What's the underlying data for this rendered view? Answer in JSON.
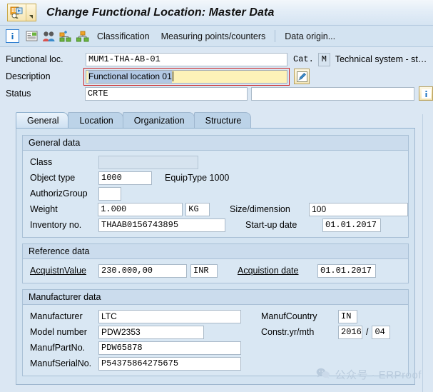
{
  "window": {
    "title": "Change Functional Location: Master Data",
    "app_icon": "sap-functional-location-icon",
    "menu_arrow": "dropdown-arrow-icon"
  },
  "toolbar": {
    "icons": [
      {
        "name": "info-icon",
        "glyph": "i"
      },
      {
        "name": "document-list-icon",
        "glyph": ""
      },
      {
        "name": "partners-icon",
        "glyph": ""
      },
      {
        "name": "create-structure-icon",
        "glyph": ""
      },
      {
        "name": "structure-hierarchy-icon",
        "glyph": ""
      }
    ],
    "buttons": [
      {
        "name": "classification-button",
        "label": "Classification"
      },
      {
        "name": "measuring-points-button",
        "label": "Measuring points/counters"
      },
      {
        "name": "data-origin-button",
        "label": "Data origin..."
      }
    ]
  },
  "header": {
    "functional_loc": {
      "label": "Functional loc.",
      "value": "MUM1-THA-AB-01"
    },
    "category": {
      "label": "Cat.",
      "value": "M",
      "description": "Technical system - st…"
    },
    "description": {
      "label": "Description",
      "value": "Functional location 01",
      "edit_icon": "pencil-edit-icon"
    },
    "status": {
      "label": "Status",
      "value": "CRTE",
      "value2": "",
      "info_icon": "status-info-icon"
    }
  },
  "tabs": [
    {
      "name": "tab-general",
      "label": "General",
      "active": true
    },
    {
      "name": "tab-location",
      "label": "Location",
      "active": false
    },
    {
      "name": "tab-organization",
      "label": "Organization",
      "active": false
    },
    {
      "name": "tab-structure",
      "label": "Structure",
      "active": false
    }
  ],
  "general_data": {
    "title": "General data",
    "class": {
      "label": "Class",
      "value": ""
    },
    "object_type": {
      "label": "Object type",
      "value": "1000",
      "text": "EquipType 1000"
    },
    "authoriz_group": {
      "label": "AuthorizGroup",
      "value": ""
    },
    "weight": {
      "label": "Weight",
      "value": "1.000",
      "uom": "KG"
    },
    "size_dimension": {
      "label": "Size/dimension",
      "value": "100"
    },
    "inventory_no": {
      "label": "Inventory no.",
      "value": "THAAB0156743895"
    },
    "startup_date": {
      "label": "Start-up date",
      "value": "01.01.2017"
    }
  },
  "reference_data": {
    "title": "Reference data",
    "acquisition_value": {
      "label": "AcquistnValue",
      "value": "230.000,00",
      "currency": "INR"
    },
    "acquisition_date": {
      "label": "Acquistion date",
      "value": "01.01.2017"
    }
  },
  "manufacturer_data": {
    "title": "Manufacturer data",
    "manufacturer": {
      "label": "Manufacturer",
      "value": "LTC"
    },
    "manuf_country": {
      "label": "ManufCountry",
      "value": "IN"
    },
    "model_number": {
      "label": "Model number",
      "value": "PDW2353"
    },
    "constr_yr_mth": {
      "label": "Constr.yr/mth",
      "year": "2016",
      "separator": "/",
      "month": "04"
    },
    "manuf_part_no": {
      "label": "ManufPartNo.",
      "value": "PDW65878"
    },
    "manuf_serial_no": {
      "label": "ManufSerialNo.",
      "value": "P54375864275675"
    }
  },
  "watermark": {
    "icon": "wechat-icon",
    "text": "公众号 · ERProof"
  },
  "colors": {
    "background": "#dbe7f3",
    "focus_border": "#cc2222",
    "input_focus_bg": "#fdf2b8",
    "selection": "#b2c8e4",
    "accent": "#2f7fd0"
  }
}
